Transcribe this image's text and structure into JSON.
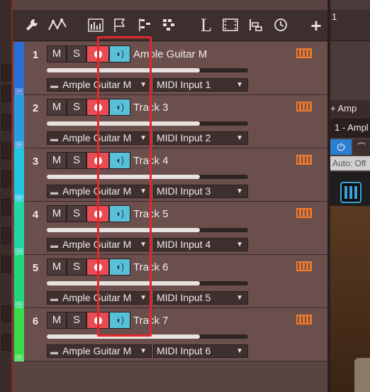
{
  "toolbar": {
    "icons": [
      "wrench-icon",
      "automation-icon",
      "mixer-icon",
      "marker-flag-icon",
      "notes-icon",
      "grid-icon",
      "listen-icon",
      "video-icon",
      "scene-icon",
      "history-icon",
      "add-icon"
    ],
    "add_label": "+"
  },
  "tracks": [
    {
      "number": "1",
      "name": "Ample Guitar M",
      "mute": "M",
      "solo": "S",
      "instrument": "Ample Guitar M",
      "input": "MIDI Input 1",
      "color": "#2a6fd6",
      "volume": 0.76
    },
    {
      "number": "2",
      "name": "Track 3",
      "mute": "M",
      "solo": "S",
      "instrument": "Ample Guitar M",
      "input": "MIDI Input 2",
      "color": "#2a9be0",
      "volume": 0.76
    },
    {
      "number": "3",
      "name": "Track 4",
      "mute": "M",
      "solo": "S",
      "instrument": "Ample Guitar M",
      "input": "MIDI Input 3",
      "color": "#22c6e0",
      "volume": 0.76
    },
    {
      "number": "4",
      "name": "Track 5",
      "mute": "M",
      "solo": "S",
      "instrument": "Ample Guitar M",
      "input": "MIDI Input 4",
      "color": "#22d6a8",
      "volume": 0.76
    },
    {
      "number": "5",
      "name": "Track 6",
      "mute": "M",
      "solo": "S",
      "instrument": "Ample Guitar M",
      "input": "MIDI Input 5",
      "color": "#22d67a",
      "volume": 0.76
    },
    {
      "number": "6",
      "name": "Track 7",
      "mute": "M",
      "solo": "S",
      "instrument": "Ample Guitar M",
      "input": "MIDI Input 6",
      "color": "#3ada4a",
      "volume": 0.76
    }
  ],
  "right_panel": {
    "track_number": "1",
    "add_label": "+ Amp",
    "instrument_name": "1 - Ampl",
    "auto_label": "Auto: Off"
  }
}
